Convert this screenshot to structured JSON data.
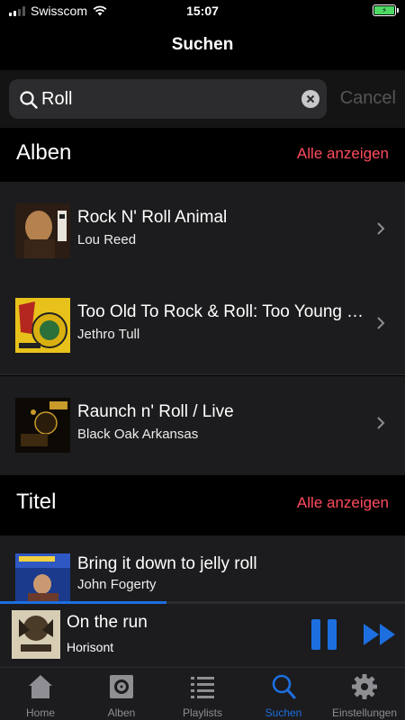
{
  "status_bar": {
    "carrier": "Swisscom",
    "time": "15:07"
  },
  "nav": {
    "title": "Suchen"
  },
  "search": {
    "value": "Roll",
    "cancel_label": "Cancel"
  },
  "albums_section": {
    "title": "Alben",
    "show_all_label": "Alle anzeigen",
    "items": [
      {
        "title": "Rock N' Roll Animal",
        "artist": "Lou Reed"
      },
      {
        "title": "Too Old To Rock & Roll: Too Young To Die!",
        "artist": "Jethro Tull"
      },
      {
        "title": "Raunch n' Roll / Live",
        "artist": "Black Oak Arkansas"
      }
    ]
  },
  "titles_section": {
    "title": "Titel",
    "show_all_label": "Alle anzeigen",
    "items": [
      {
        "title": "Bring it down to jelly roll",
        "artist": "John Fogerty"
      }
    ]
  },
  "player": {
    "title": "On the run",
    "artist": "Horisont",
    "progress": 0.41
  },
  "tabs": [
    {
      "label": "Home",
      "icon": "home-icon"
    },
    {
      "label": "Alben",
      "icon": "album-icon"
    },
    {
      "label": "Playlists",
      "icon": "list-icon"
    },
    {
      "label": "Suchen",
      "icon": "search-icon",
      "active": true
    },
    {
      "label": "Einstellungen",
      "icon": "gear-icon"
    }
  ],
  "colors": {
    "accent": "#1d6fe0",
    "show_all": "#ff4b5e",
    "row_bg": "#1c1c1e"
  }
}
